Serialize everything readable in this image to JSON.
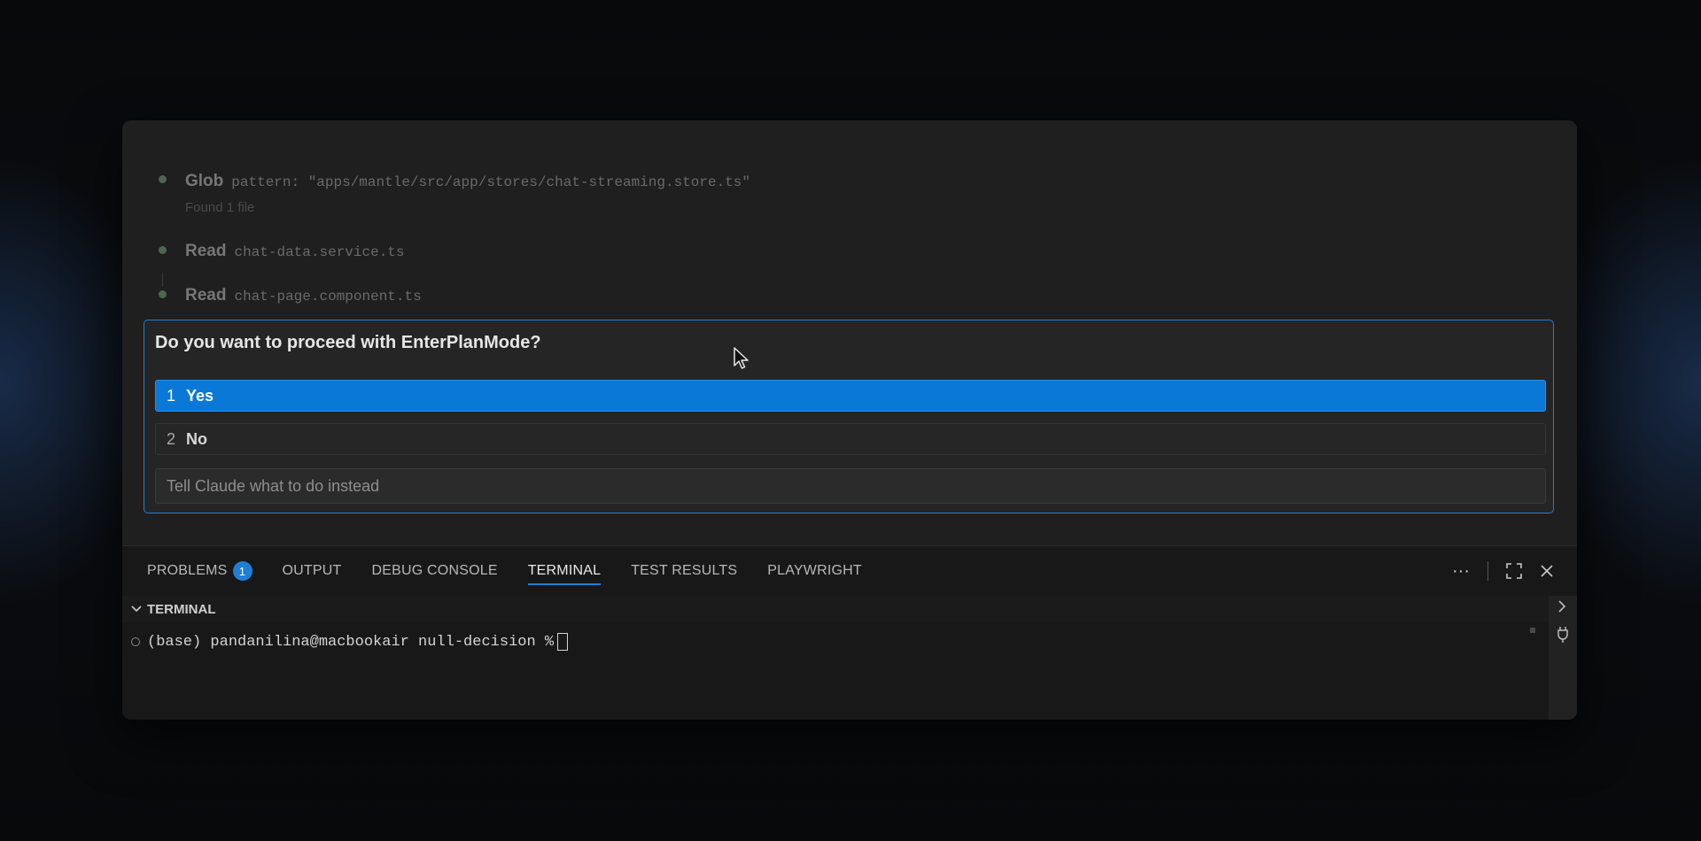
{
  "chat": {
    "tools": [
      {
        "name": "Glob",
        "arg": "pattern: \"apps/mantle/src/app/stores/chat-streaming.store.ts\"",
        "result": "Found 1 file"
      },
      {
        "name": "Read",
        "arg": "chat-data.service.ts",
        "result": ""
      },
      {
        "name": "Read",
        "arg": "chat-page.component.ts",
        "result": ""
      }
    ]
  },
  "prompt": {
    "title": "Do you want to proceed with EnterPlanMode?",
    "options": [
      {
        "num": "1",
        "label": "Yes",
        "selected": true
      },
      {
        "num": "2",
        "label": "No",
        "selected": false
      }
    ],
    "input_placeholder": "Tell Claude what to do instead"
  },
  "panel": {
    "tabs": [
      {
        "label": "PROBLEMS",
        "badge": "1",
        "active": false
      },
      {
        "label": "OUTPUT",
        "active": false
      },
      {
        "label": "DEBUG CONSOLE",
        "active": false
      },
      {
        "label": "TERMINAL",
        "active": true
      },
      {
        "label": "TEST RESULTS",
        "active": false
      },
      {
        "label": "PLAYWRIGHT",
        "active": false
      }
    ],
    "actions": {
      "more": "···",
      "maximize": "⛶",
      "close": "✕"
    },
    "terminal_title": "TERMINAL",
    "terminal_line": "(base) pandanilina@macbookair null-decision %",
    "icons": [
      "more-icon",
      "maximize-icon",
      "close-icon",
      "chevron-down-icon",
      "chevron-right-icon",
      "plug-icon"
    ]
  },
  "colors": {
    "accent": "#1e7fd6",
    "selected_option": "#0a78d6",
    "window_bg": "#1e1e1e"
  }
}
